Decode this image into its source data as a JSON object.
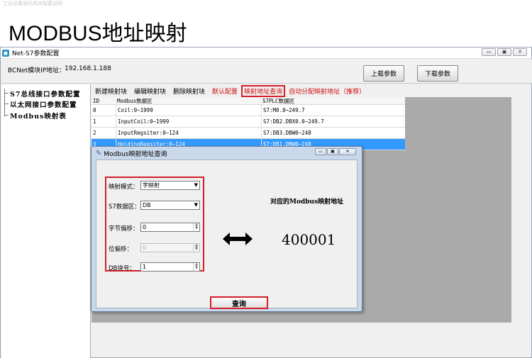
{
  "watermark": "工业设备通讯网关配置说明",
  "page_heading": "MODBUS地址映射",
  "window": {
    "title": "Net-S7参数配置",
    "controls": [
      "▭",
      "▣",
      "✕"
    ]
  },
  "ip_bar": {
    "label": "BCNet模块IP地址：",
    "value": "192.168.1.188",
    "upload_label": "上载参数",
    "download_label": "下载参数"
  },
  "tree": {
    "items": [
      {
        "label": "S7总线接口参数配置"
      },
      {
        "label": "以太网接口参数配置"
      },
      {
        "label": "Modbus映射表"
      }
    ]
  },
  "menu": {
    "items": [
      {
        "label": "新建映射块"
      },
      {
        "label": "编辑映射块"
      },
      {
        "label": "删除映射块"
      },
      {
        "label": "默认配置"
      },
      {
        "label": "映射地址查询"
      },
      {
        "label": "自动分配映射地址（推荐）"
      }
    ]
  },
  "grid": {
    "headers": [
      "ID",
      "Modbus数据区",
      "S7PLC数据区"
    ],
    "rows": [
      {
        "id": "0",
        "modbus": "Coil:0~1999",
        "s7": "S7:M0.0~249.7"
      },
      {
        "id": "1",
        "modbus": "InputCoil:0~1999",
        "s7": "S7:DB2.DBX0.0~249.7"
      },
      {
        "id": "2",
        "modbus": "InputRegsiter:0~124",
        "s7": "S7:DB3.DBW0~248"
      },
      {
        "id": "3",
        "modbus": "HoldingRegsiter:0~124",
        "s7": "S7:DB1.DBW0~248"
      }
    ]
  },
  "dialog": {
    "title": "Modbus映射地址查询",
    "mode_label": "映射模式：",
    "mode_value": "字映射",
    "s7area_label": "S7数据区：",
    "s7area_value": "DB",
    "byte_offset_label": "字节偏移：",
    "byte_offset_value": "0",
    "bit_offset_label": "位偏移：",
    "bit_offset_value": "0",
    "db_label": "DB块号：",
    "db_value": "1",
    "result_title": "对应的Modbus映射地址",
    "result_value": "400001",
    "query_label": "查询"
  },
  "colors": {
    "highlight_red": "#d51e2a",
    "selection_blue": "#3399ff",
    "menu_red": "#d01010"
  }
}
